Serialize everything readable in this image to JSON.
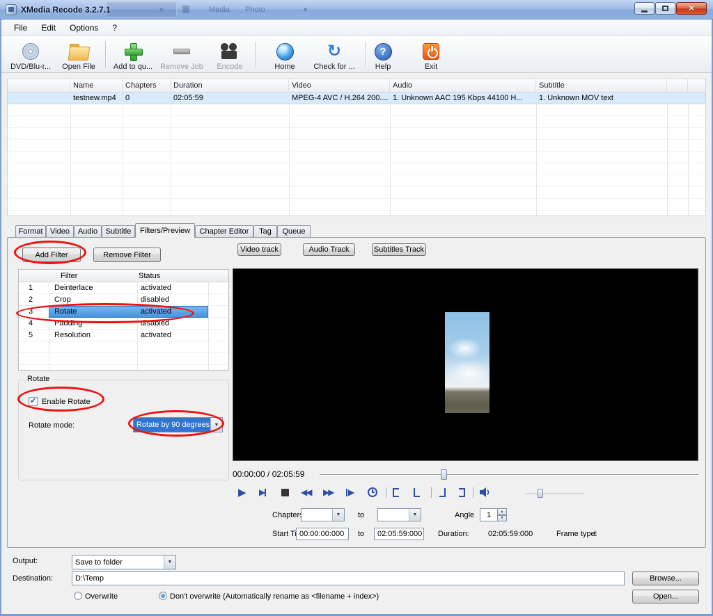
{
  "window": {
    "title": "XMedia Recode 3.2.7.1"
  },
  "titlebar_ghost": {
    "text1": "Media",
    "text2": "Photo"
  },
  "menubar": {
    "items": [
      {
        "label": "File"
      },
      {
        "label": "Edit"
      },
      {
        "label": "Options"
      },
      {
        "label": "?"
      }
    ]
  },
  "toolbar": {
    "buttons": [
      {
        "label": "DVD/Blu-r...",
        "icon": "dvd-disc-icon",
        "disabled": false
      },
      {
        "label": "Open File",
        "icon": "open-folder-icon",
        "disabled": false
      },
      {
        "label": "Add to qu...",
        "icon": "add-plus-icon",
        "disabled": false
      },
      {
        "label": "Remove Job",
        "icon": "remove-minus-icon",
        "disabled": true
      },
      {
        "label": "Encode",
        "icon": "movie-camera-icon",
        "disabled": true
      },
      {
        "label": "Home",
        "icon": "globe-icon",
        "disabled": false
      },
      {
        "label": "Check for ...",
        "icon": "refresh-arrows-icon",
        "disabled": false
      },
      {
        "label": "Help",
        "icon": "question-mark-icon",
        "disabled": false
      },
      {
        "label": "Exit",
        "icon": "power-exit-icon",
        "disabled": false
      }
    ]
  },
  "job_list": {
    "columns": [
      "Name",
      "Chapters",
      "Duration",
      "Video",
      "Audio",
      "Subtitle"
    ],
    "rows": [
      {
        "name": "testnew.mp4",
        "chapters": "0",
        "duration": "02:05:59",
        "video": "MPEG-4 AVC / H.264 200....",
        "audio": "1. Unknown AAC  195 Kbps 44100 H...",
        "subtitle": "1. Unknown MOV text"
      }
    ]
  },
  "tabs": {
    "items": [
      {
        "label": "Format"
      },
      {
        "label": "Video"
      },
      {
        "label": "Audio"
      },
      {
        "label": "Subtitle"
      },
      {
        "label": "Filters/Preview"
      },
      {
        "label": "Chapter Editor"
      },
      {
        "label": "Tag"
      },
      {
        "label": "Queue"
      }
    ],
    "active": "Filters/Preview"
  },
  "filters": {
    "add_filter_button": "Add Filter",
    "remove_filter_button": "Remove Filter",
    "table": {
      "columns": [
        "Filter",
        "Status"
      ],
      "rows": [
        {
          "index": "1",
          "filter": "Deinterlace",
          "status": "activated",
          "selected": false
        },
        {
          "index": "2",
          "filter": "Crop",
          "status": "disabled",
          "selected": false
        },
        {
          "index": "3",
          "filter": "Rotate",
          "status": "activated",
          "selected": true
        },
        {
          "index": "4",
          "filter": "Padding",
          "status": "disabled",
          "selected": false
        },
        {
          "index": "5",
          "filter": "Resolution",
          "status": "activated",
          "selected": false
        }
      ]
    },
    "rotate_group": {
      "legend": "Rotate",
      "checkbox_label": "Enable Rotate",
      "checkbox_checked": true,
      "mode_label": "Rotate mode:",
      "mode_value": "Rotate by 90 degrees"
    }
  },
  "preview": {
    "track_buttons": [
      {
        "label": "Video track"
      },
      {
        "label": "Audio Track"
      },
      {
        "label": "Subtitles Track"
      }
    ],
    "time_display": "00:00:00 / 02:05:59",
    "chapters_label": "Chapters:",
    "chapters_to": "to",
    "angle_label": "Angle",
    "angle_value": "1",
    "start_time_label": "Start Time",
    "start_time_from": "00:00:00:000",
    "start_time_to_label": "to",
    "start_time_to": "02:05:59:000",
    "duration_label": "Duration:",
    "duration_value": "02:05:59:000",
    "frame_type_label": "Frame type:",
    "frame_type_value": "I"
  },
  "output": {
    "output_label": "Output:",
    "mode_value": "Save to folder",
    "destination_label": "Destination:",
    "destination_value": "D:\\Temp",
    "browse_button": "Browse...",
    "open_button": "Open...",
    "overwrite_label": "Overwrite",
    "overwrite_selected": false,
    "dont_overwrite_label": "Don't overwrite (Automatically rename as <filename + index>)",
    "dont_overwrite_selected": true
  }
}
